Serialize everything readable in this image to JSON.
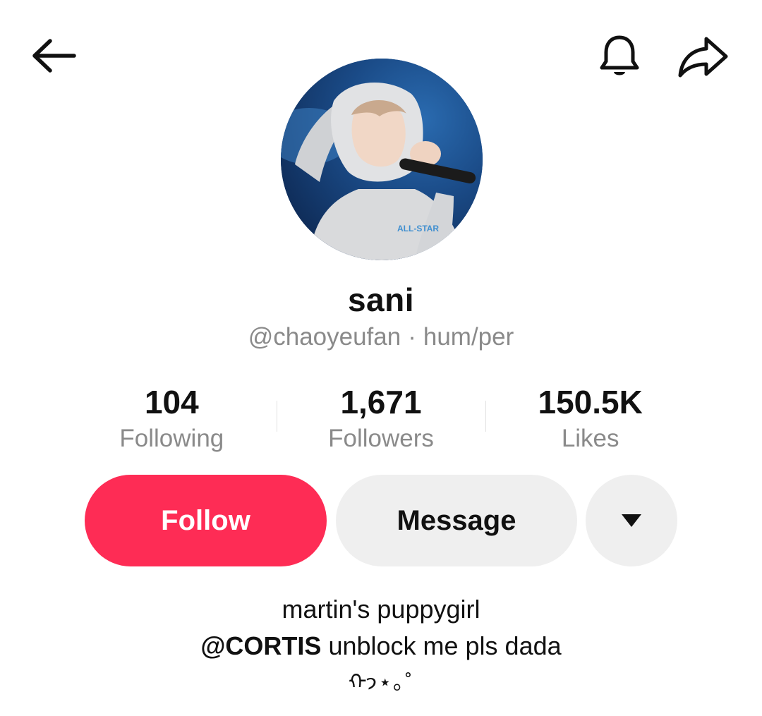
{
  "header": {
    "back_icon": "arrow-left-icon",
    "bell_icon": "bell-icon",
    "share_icon": "share-arrow-icon"
  },
  "profile": {
    "avatar_icon": "profile-photo",
    "display_name": "sani",
    "handle": "@chaoyeufan",
    "separator": "·",
    "pronouns": "hum/per"
  },
  "stats": [
    {
      "value": "104",
      "label": "Following"
    },
    {
      "value": "1,671",
      "label": "Followers"
    },
    {
      "value": "150.5K",
      "label": "Likes"
    }
  ],
  "actions": {
    "follow_label": "Follow",
    "message_label": "Message",
    "more_icon": "caret-down-icon"
  },
  "bio": {
    "line1": "martin's puppygirl",
    "mention": "@CORTIS",
    "line2_rest": " unblock me pls dada",
    "line3": "ᡣ𐭩⋆｡˚"
  },
  "colors": {
    "follow_bg": "#fe2c55",
    "secondary_bg": "#efefef",
    "muted_text": "#8a8a8a"
  }
}
